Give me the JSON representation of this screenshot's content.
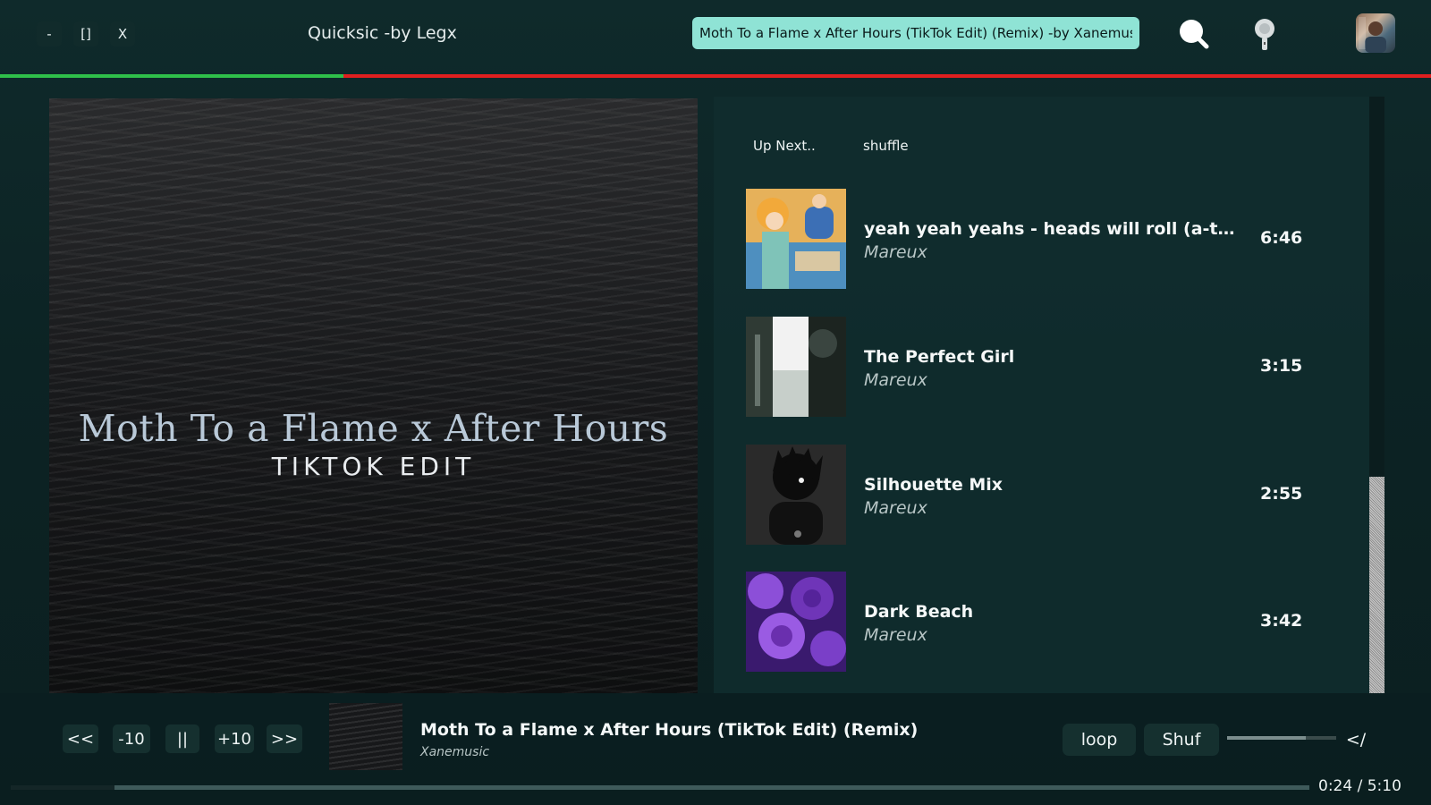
{
  "window": {
    "minimize_label": "-",
    "maximize_label": "[]",
    "close_label": "X",
    "title": "Quicksic -by Legx"
  },
  "search": {
    "value": "Moth To a Flame x After Hours (TikTok Edit) (Remix) -by Xanemusic"
  },
  "icons": {
    "search": "search-icon",
    "mic": "microphone-icon",
    "avatar": "user-avatar"
  },
  "top_progress": {
    "fraction": 0.24
  },
  "colors": {
    "progress_played": "#2fbf4a",
    "progress_remaining": "#e01f1f",
    "search_bg": "#8fe3d5"
  },
  "cover": {
    "title": "Moth To a Flame x After Hours",
    "subtitle": "TIKTOK EDIT"
  },
  "panel": {
    "tabs": [
      {
        "label": "Up Next.."
      },
      {
        "label": "shuffle"
      }
    ],
    "queue": [
      {
        "title": "yeah yeah yeahs - heads will roll (a-trak r...",
        "artist": "Mareux",
        "duration": "6:46"
      },
      {
        "title": "The Perfect Girl",
        "artist": "Mareux",
        "duration": "3:15"
      },
      {
        "title": "Silhouette Mix",
        "artist": "Mareux",
        "duration": "2:55"
      },
      {
        "title": "Dark Beach",
        "artist": "Mareux",
        "duration": "3:42"
      }
    ]
  },
  "player": {
    "controls": {
      "prev": "<<",
      "back10": "-10",
      "pause": "||",
      "fwd10": "+10",
      "next": ">>"
    },
    "now_playing": {
      "title": "Moth To a Flame x After Hours (TikTok Edit) (Remix)",
      "artist": "Xanemusic"
    },
    "loop_label": "loop",
    "shuffle_label": "Shuf",
    "code_label": "</",
    "volume": 0.72,
    "seek_fraction": 0.08,
    "time": "0:24 / 5:10"
  }
}
